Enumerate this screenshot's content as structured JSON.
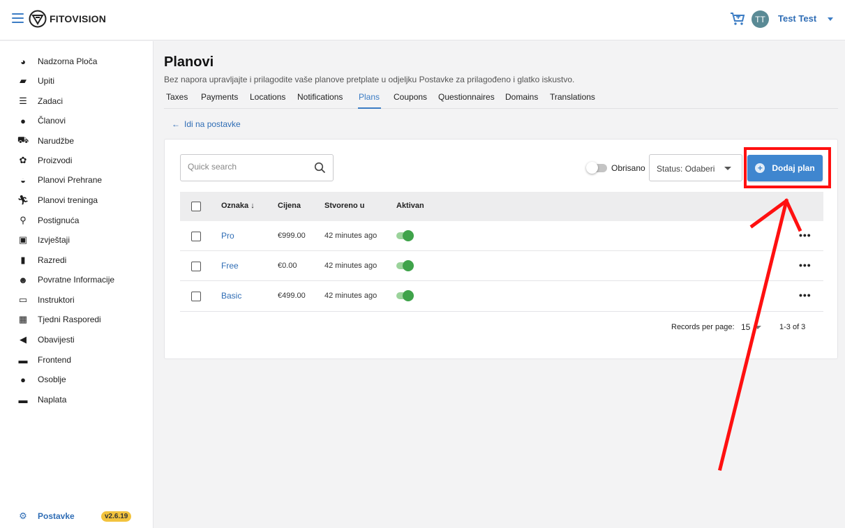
{
  "app": {
    "brand": "FITOVISION",
    "user": {
      "initials": "TT",
      "name": "Test Test"
    }
  },
  "sidebar": {
    "items": [
      {
        "label": "Nadzorna Ploča",
        "icon": "dashboard-icon"
      },
      {
        "label": "Upiti",
        "icon": "inquiries-icon"
      },
      {
        "label": "Zadaci",
        "icon": "tasks-icon"
      },
      {
        "label": "Članovi",
        "icon": "members-icon"
      },
      {
        "label": "Narudžbe",
        "icon": "cart-icon"
      },
      {
        "label": "Proizvodi",
        "icon": "products-icon"
      },
      {
        "label": "Planovi Prehrane",
        "icon": "bowl-icon"
      },
      {
        "label": "Planovi treninga",
        "icon": "running-icon"
      },
      {
        "label": "Postignuća",
        "icon": "medal-icon"
      },
      {
        "label": "Izvještaji",
        "icon": "reports-icon"
      },
      {
        "label": "Razredi",
        "icon": "classes-icon"
      },
      {
        "label": "Povratne Informacije",
        "icon": "smiley-icon"
      },
      {
        "label": "Instruktori",
        "icon": "instructor-icon"
      },
      {
        "label": "Tjedni Rasporedi",
        "icon": "calendar-icon"
      },
      {
        "label": "Obavijesti",
        "icon": "megaphone-icon"
      },
      {
        "label": "Frontend",
        "icon": "window-icon"
      },
      {
        "label": "Osoblje",
        "icon": "staff-icon"
      },
      {
        "label": "Naplata",
        "icon": "card-icon"
      }
    ],
    "settings": {
      "label": "Postavke",
      "version": "v2.6.19"
    }
  },
  "page": {
    "title": "Planovi",
    "subtitle": "Bez napora upravljajte i prilagodite vaše planove pretplate u odjeljku Postavke za prilagođeno i glatko iskustvo.",
    "tabs": [
      "Taxes",
      "Payments",
      "Locations",
      "Notifications",
      "Plans",
      "Coupons",
      "Questionnaires",
      "Domains",
      "Translations"
    ],
    "active_tab": "Plans",
    "back_link": "Idi na postavke"
  },
  "toolbar": {
    "search_placeholder": "Quick search",
    "deleted_toggle_label": "Obrisano",
    "status_select": "Status: Odaberi",
    "add_button": "Dodaj plan"
  },
  "table": {
    "columns": [
      "Oznaka",
      "Cijena",
      "Stvoreno u",
      "Aktivan"
    ],
    "rows": [
      {
        "name": "Pro",
        "price": "€999.00",
        "created": "42 minutes ago",
        "active": true
      },
      {
        "name": "Free",
        "price": "€0.00",
        "created": "42 minutes ago",
        "active": true
      },
      {
        "name": "Basic",
        "price": "€499.00",
        "created": "42 minutes ago",
        "active": true
      }
    ],
    "records_per_page_label": "Records per page:",
    "records_per_page": "15",
    "range": "1-3 of 3"
  },
  "colors": {
    "accent": "#3f86cf",
    "annotation": "#ff1010",
    "toggle_on": "#3fa34a",
    "badge": "#f2c33e"
  }
}
